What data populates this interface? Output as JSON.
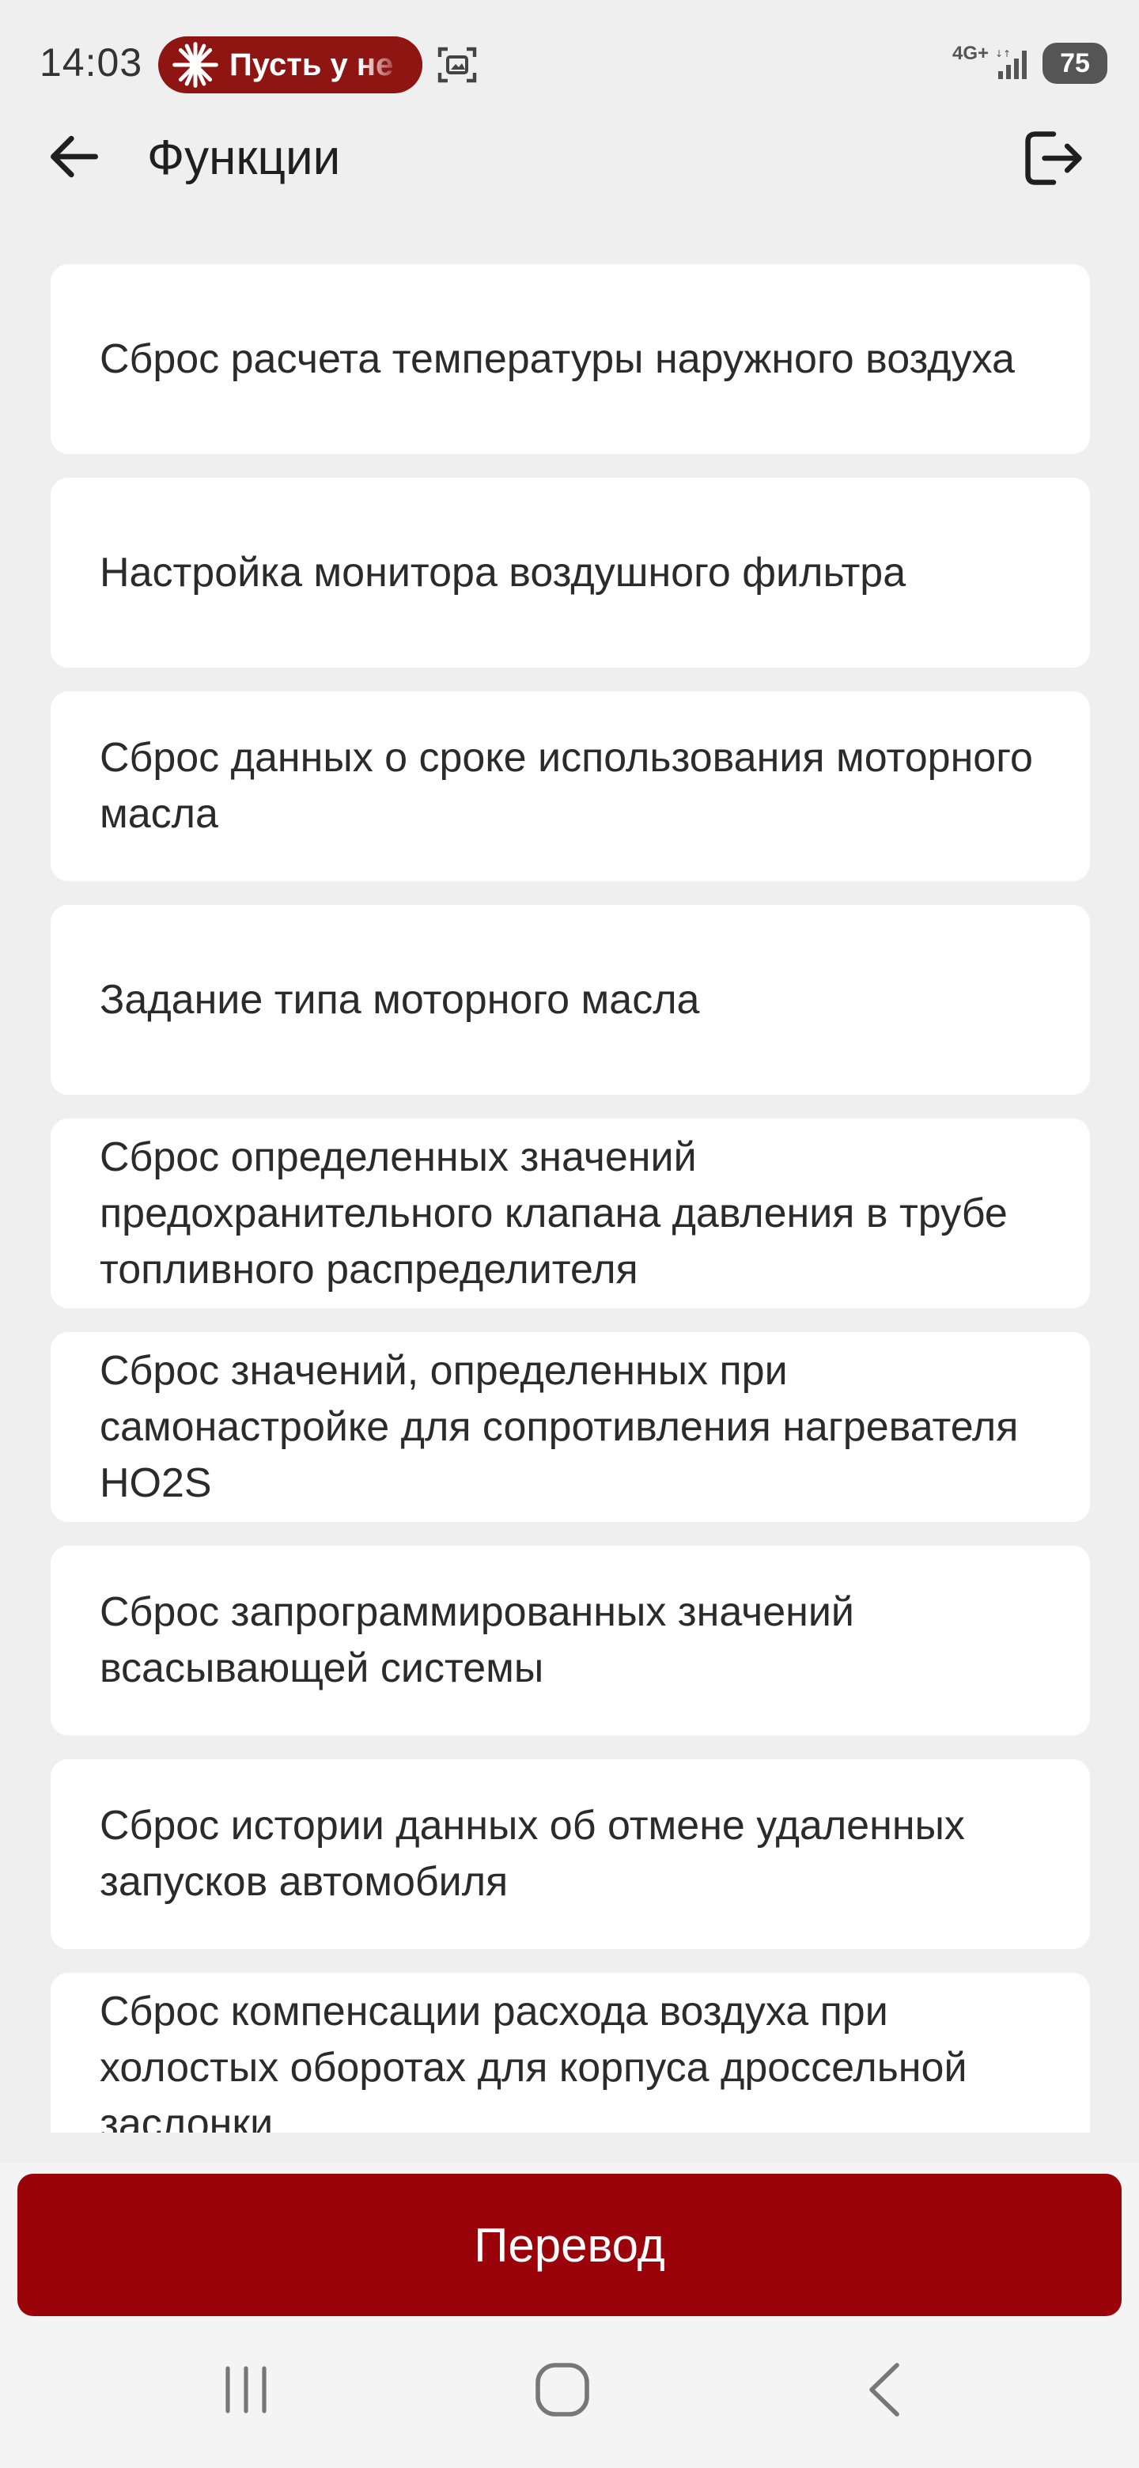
{
  "status_bar": {
    "time": "14:03",
    "notification_text": "Пусть у не",
    "network": "4G+",
    "battery": "75"
  },
  "app_bar": {
    "title": "Функции"
  },
  "functions": [
    "Сброс расчета температуры наружного воздуха",
    "Настройка монитора воздушного фильтра",
    "Сброс данных о сроке использования моторного масла",
    "Задание типа моторного масла",
    "Сброс определенных значений предохранительного клапана давления в трубе топливного распределителя",
    "Сброс значений, определенных при самонастройке для сопротивления нагревателя HO2S",
    "Сброс запрограммированных значений всасывающей системы",
    "Сброс истории данных об отмене удаленных запусков автомобиля",
    "Сброс компенсации расхода воздуха при холостых оборотах для корпуса дроссельной заслонки"
  ],
  "translate_button": "Перевод",
  "colors": {
    "accent": "#9b030b",
    "background": "#efefef",
    "card": "#ffffff"
  }
}
